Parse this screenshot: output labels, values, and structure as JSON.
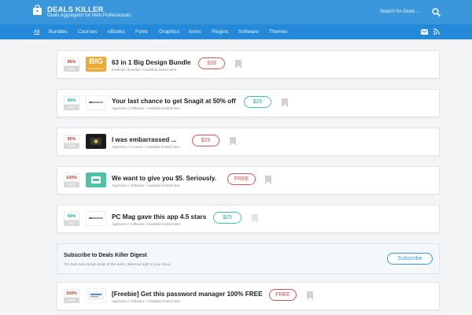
{
  "header": {
    "brand": "DEALS KILLER",
    "tagline": "Deals Aggregator for Web Professionals",
    "search_placeholder": "Search for Deals ..."
  },
  "nav": {
    "items": [
      "All",
      "Bundles",
      "Courses",
      "eBooks",
      "Fonts",
      "Graphics",
      "Icons",
      "Plugins",
      "Software",
      "Themes"
    ],
    "active": "All"
  },
  "deals": [
    {
      "percent": "95%",
      "off": "OFF",
      "title": "63 in 1 Big Design Bundle",
      "meta": "Dealfuel / Bundles / Available limited time",
      "price": "$39",
      "thumb_text": "BIG",
      "thumb_sub": "Design Bundle"
    },
    {
      "percent": "49%",
      "off": "OFF",
      "title": "Your last chance to get Snagit at 50% off",
      "meta": "AppSumo / Software / Available limited time",
      "price": "$25"
    },
    {
      "percent": "95%",
      "off": "OFF",
      "title": "I was embarrassed ...",
      "meta": "AppSumo / Courses / Available limited time",
      "price": "$25"
    },
    {
      "percent": "100%",
      "off": "OFF",
      "title": "We want to give you $5. Seriously.",
      "meta": "AppSumo / Software / Available limited time",
      "price": "FREE"
    },
    {
      "percent": "49%",
      "off": "OFF",
      "title": "PC Mag gave this app 4.5 stars",
      "meta": "AppSumo / Software / Available limited time",
      "price": "$25"
    },
    {
      "percent": "100%",
      "off": "OFF",
      "title": "[Freebie] Get this password manager 100% FREE",
      "meta": "AppSumo / Software / Available limited time",
      "price": "FREE"
    }
  ],
  "subscribe": {
    "title": "Subscribe to Deals Killer Digest",
    "description": "The best web design deals of the week, delivered right to your inbox.",
    "button": "Subscribe"
  },
  "colors": {
    "header": "#3a97dc",
    "nav": "#2389d8",
    "red_accent": "#d9534f",
    "teal_accent": "#3cc4ac"
  }
}
